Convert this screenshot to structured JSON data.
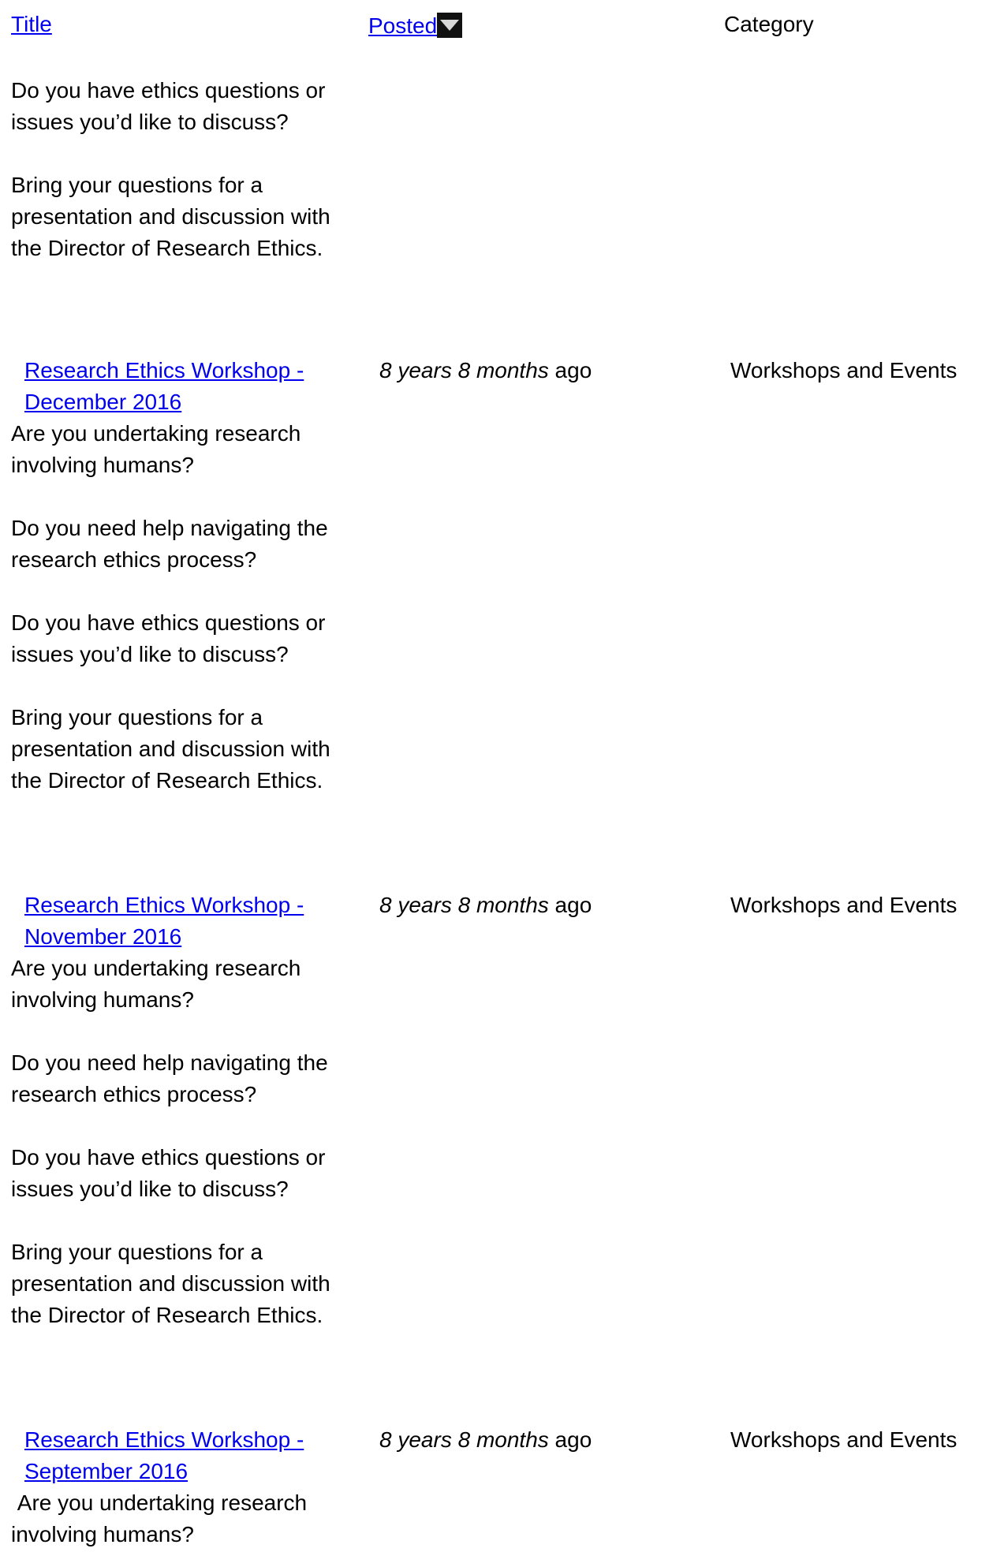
{
  "header": {
    "title_label": "Title",
    "posted_label": "Posted",
    "category_label": "Category"
  },
  "lead_text": {
    "p1": "Do you have ethics questions or issues you’d like to discuss?",
    "p2": "Bring your questions for a presentation and discussion with the Director of Research Ethics."
  },
  "rows": [
    {
      "title": "Research Ethics Workshop - December 2016",
      "posted_italic": "8 years 8 months",
      "posted_suffix": " ago",
      "category": "Workshops and Events",
      "body": [
        "Are you undertaking research involving humans?",
        "Do you need help navigating the research ethics process?",
        "Do you have ethics questions or issues you’d like to discuss?",
        "Bring your questions for a presentation and discussion with the Director of Research Ethics."
      ]
    },
    {
      "title": "Research Ethics Workshop - November 2016",
      "posted_italic": "8 years 8 months",
      "posted_suffix": " ago",
      "category": "Workshops and Events",
      "body": [
        "Are you undertaking research involving humans?",
        "Do you need help navigating the research ethics process?",
        "Do you have ethics questions or issues you’d like to discuss?",
        "Bring your questions for a presentation and discussion with the Director of Research Ethics."
      ]
    },
    {
      "title": "Research Ethics Workshop - September 2016",
      "posted_italic": "8 years 8 months",
      "posted_suffix": " ago",
      "category": "Workshops and Events",
      "body": [
        " Are you undertaking research involving humans?"
      ]
    }
  ],
  "colors": {
    "link": "#0000ee",
    "text": "#000000",
    "background": "#ffffff"
  }
}
